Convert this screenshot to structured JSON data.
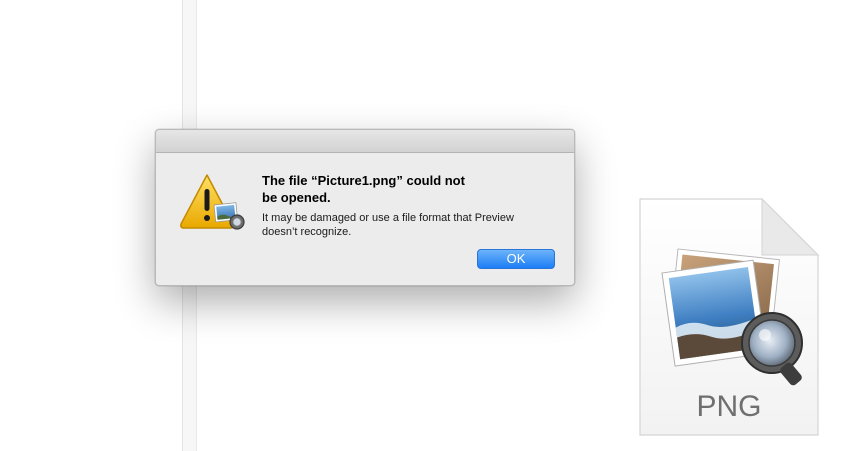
{
  "dialog": {
    "title_line1": "The file “Picture1.png” could not",
    "title_line2": "be opened.",
    "message_line1": "It may be damaged or use a file format that Preview",
    "message_line2": "doesn’t recognize.",
    "ok_label": "OK",
    "icon": "warning-triangle-with-preview-badge"
  },
  "file_icon": {
    "extension_label": "PNG",
    "icon": "preview-png-document"
  },
  "colors": {
    "button_blue": "#1d7ef5",
    "warning_yellow": "#f4c21f"
  }
}
